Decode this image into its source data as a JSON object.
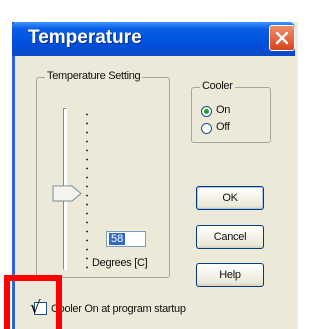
{
  "window": {
    "title": "Temperature"
  },
  "temperature_group": {
    "label": "Temperature Setting",
    "value": "58",
    "units_label": "Degrees [C]"
  },
  "cooler_group": {
    "label": "Cooler",
    "options": [
      "On",
      "Off"
    ],
    "selected": "On"
  },
  "buttons": {
    "ok": "OK",
    "cancel": "Cancel",
    "help": "Help"
  },
  "startup_checkbox": {
    "label": "Cooler On at program startup",
    "mark": "√",
    "checked": true
  },
  "colors": {
    "title_bar": "#0054e3",
    "highlight": "#ff0000",
    "selection": "#316ac5"
  }
}
